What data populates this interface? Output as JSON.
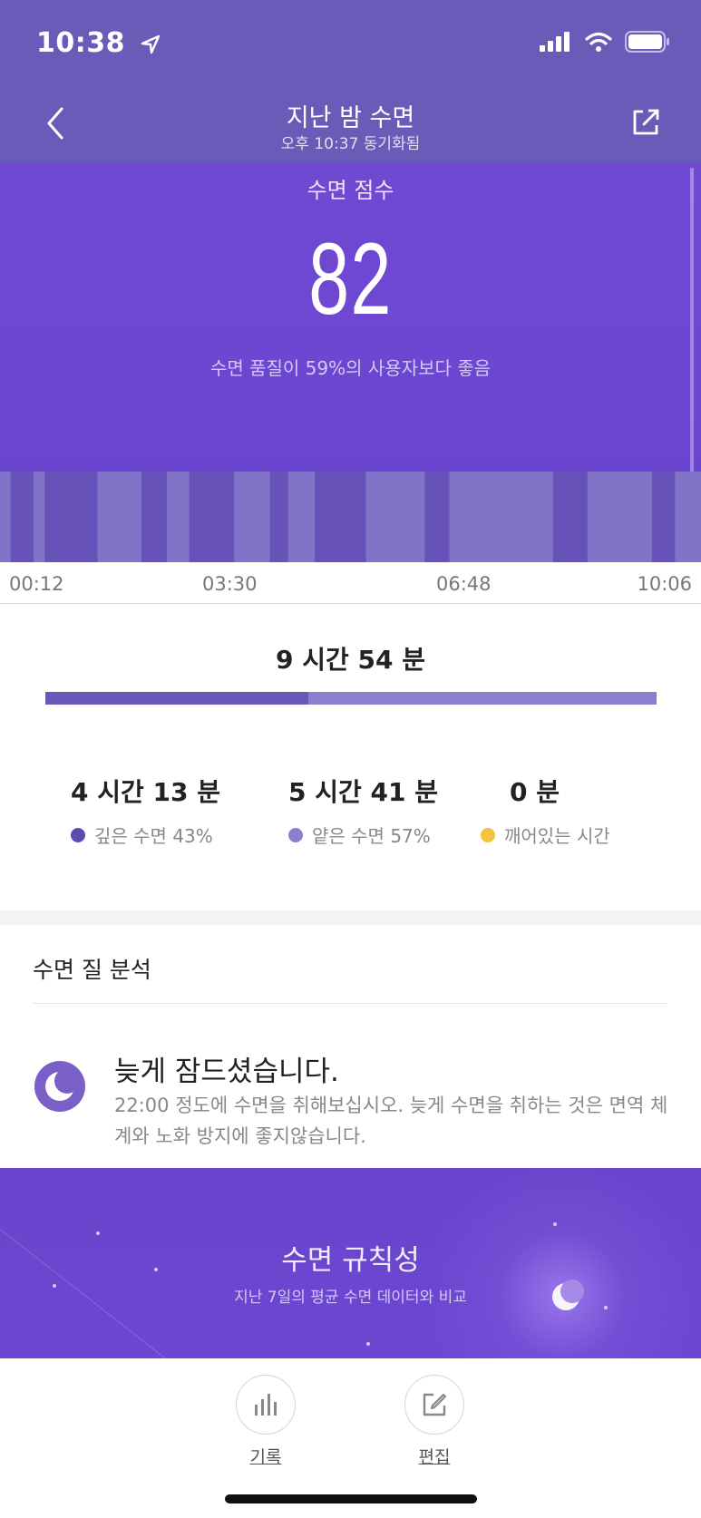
{
  "status_bar": {
    "time": "10:38"
  },
  "header": {
    "title": "지난 밤 수면",
    "subtitle": "오후 10:37 동기화됨"
  },
  "score": {
    "label": "수면 점수",
    "value": "82",
    "description": "수면 품질이 59%의 사용자보다 좋음"
  },
  "timeline": {
    "ticks": [
      "00:12",
      "03:30",
      "06:48",
      "10:06"
    ],
    "deep_stage_segments": [
      {
        "start": 0.015,
        "end": 0.048
      },
      {
        "start": 0.064,
        "end": 0.139
      },
      {
        "start": 0.202,
        "end": 0.238
      },
      {
        "start": 0.27,
        "end": 0.334
      },
      {
        "start": 0.385,
        "end": 0.411
      },
      {
        "start": 0.449,
        "end": 0.522
      },
      {
        "start": 0.606,
        "end": 0.641
      },
      {
        "start": 0.789,
        "end": 0.838
      },
      {
        "start": 0.93,
        "end": 0.963
      }
    ]
  },
  "summary": {
    "total_label": "9 시간 54 분",
    "deep_fraction": 0.43,
    "stats": [
      {
        "value": "4 시간 13 분",
        "label": "깊은 수면 43%",
        "color": "#5e4bb0"
      },
      {
        "value": "5 시간 41 분",
        "label": "얕은 수면 57%",
        "color": "#8b7fd0"
      },
      {
        "value": "0 분",
        "label": "깨어있는 시간",
        "color": "#f4c33d"
      }
    ]
  },
  "analysis": {
    "section_title": "수면 질 분석",
    "icon": "moon-icon",
    "title": "늦게 잠드셨습니다.",
    "body": "22:00 정도에 수면을 취해보십시오. 늦게 수면을 취하는 것은 면역 체계와 노화 방지에 좋지않습니다."
  },
  "regularity": {
    "title": "수면 규칙성",
    "subtitle": "지난 7일의 평균 수면 데이터와 비교"
  },
  "bottom_actions": [
    {
      "label": "기록",
      "icon": "bar-chart-icon"
    },
    {
      "label": "편집",
      "icon": "edit-icon"
    }
  ],
  "colors": {
    "deep": "#6652b8",
    "light": "#8074c8",
    "accent": "#6b45d0",
    "awake": "#f4c33d"
  }
}
